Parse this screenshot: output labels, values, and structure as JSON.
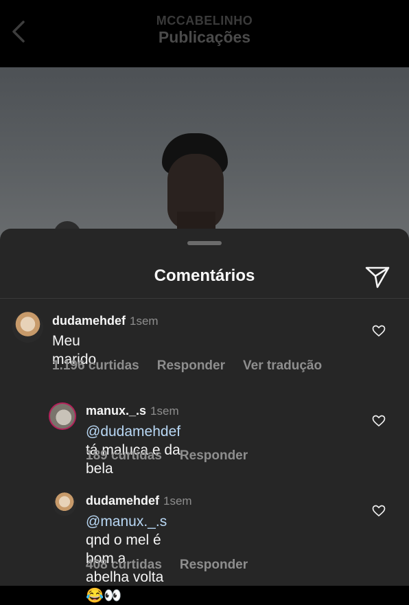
{
  "header": {
    "username": "MCCABELINHO",
    "title": "Publicações"
  },
  "sheet": {
    "title": "Comentários"
  },
  "comments": [
    {
      "username": "dudamehdef",
      "time": "1sem",
      "text": "Meu marido",
      "likes": "1.196 curtidas",
      "reply": "Responder",
      "translate": "Ver tradução"
    },
    {
      "username": "manux._.s",
      "time": "1sem",
      "mention": "@dudamehdef",
      "text": " tá maluca e da bela",
      "likes": "189 curtidas",
      "reply": "Responder"
    },
    {
      "username": "dudamehdef",
      "time": "1sem",
      "mention": "@manux._.s",
      "text_line1": " qnd o mel é bom a",
      "text_line2": "abelha volta 😂👀",
      "likes": "408 curtidas",
      "reply": "Responder"
    }
  ],
  "colors": {
    "sheet_bg": "#262626",
    "muted": "#8e8e8e",
    "mention": "#b9d8f5"
  },
  "icons": [
    "chevron-left-icon",
    "send-icon",
    "heart-outline-icon"
  ]
}
